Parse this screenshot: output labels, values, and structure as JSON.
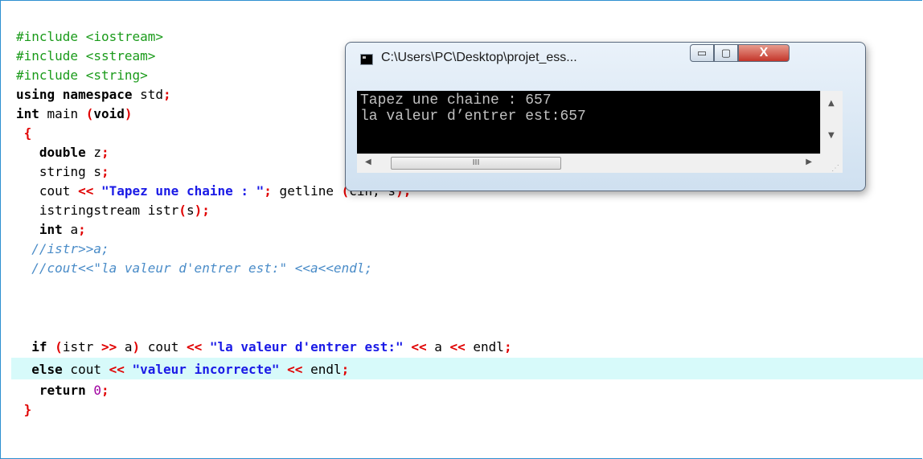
{
  "code": {
    "include1": "#include <iostream>",
    "include2": "#include <sstream>",
    "include3": "#include <string>",
    "using_kw": "using namespace",
    "using_rest": " std",
    "semi": ";",
    "main_kw": "int",
    "main_name": " main ",
    "main_paren_open": "(",
    "main_void": "void",
    "main_paren_close": ")",
    "brace_open": "{",
    "l7_kw": "double",
    "l7_rest": " z",
    "l8_rest": "string s",
    "l9_cout": "cout ",
    "op_shift": "<<",
    "l9_str": "\"Tapez une chaine : \"",
    "l9_getline": " getline ",
    "l9_args": "cin, s",
    "l10_a": "istringstream istr",
    "l10_arg": "s",
    "l11_kw": "int",
    "l11_rest": " a",
    "l12": "//istr>>a;",
    "l13": "//cout<<\"la valeur d'entrer est:\" <<a<<endl;",
    "l14_kw": "if",
    "l14_a": "istr ",
    "op_rshift": ">>",
    "l14_b": " a",
    "l14_cout": " cout ",
    "l14_str": "\"la valeur d'entrer est:\"",
    "l14_c": " a ",
    "l14_endl": " endl",
    "l15_kw": "else",
    "l15_cout": " cout ",
    "l15_str": "\"valeur incorrecte\"",
    "l15_endl": " endl",
    "l16_kw": "return",
    "l16_num": "0",
    "brace_close": "}"
  },
  "console_window": {
    "title": "C:\\Users\\PC\\Desktop\\projet_ess...",
    "output": [
      "Tapez une chaine : 657",
      "la valeur d’entrer est:657"
    ],
    "minimize_label": "▭",
    "maximize_label": "▢",
    "close_label": "X",
    "hscroll_grip": "III"
  },
  "colors": {
    "preprocessor": "#1b9b1b",
    "operator": "#e00000",
    "string": "#1a1ae6",
    "comment": "#4a8cc8",
    "number": "#a000a0",
    "highlight_line": "#d7fafa"
  }
}
